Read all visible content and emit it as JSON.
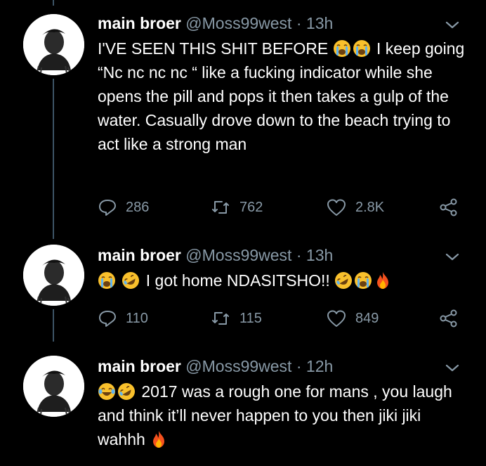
{
  "tweets": [
    {
      "name": "main broer",
      "handle": "@Moss99west",
      "separator": "·",
      "time": "13h",
      "lines": [
        [
          "emoji:sob",
          "emoji:sob"
        ],
        []
      ],
      "text_parts": {
        "a": "I'VE SEEN THIS SHIT BEFORE",
        "b": "I keep going “Nc nc nc nc “ like a fucking indicator while she opens the pill and pops it then takes a gulp of the water. Casually drove down to the beach trying to act like a strong man"
      },
      "emojis": [
        "crying-face-emoji",
        "crying-face-emoji"
      ],
      "replies": "286",
      "retweets": "762",
      "likes": "2.8K"
    },
    {
      "name": "main broer",
      "handle": "@Moss99west",
      "separator": "·",
      "time": "13h",
      "text_parts": {
        "a": "I got home NDASITSHO!!"
      },
      "emojis_before": [
        "crying-face-emoji",
        "rolling-laughing-emoji"
      ],
      "emojis_after": [
        "rolling-laughing-emoji",
        "crying-face-emoji",
        "fire-emoji"
      ],
      "replies": "110",
      "retweets": "115",
      "likes": "849"
    },
    {
      "name": "main broer",
      "handle": "@Moss99west",
      "separator": "·",
      "time": "12h",
      "text_parts": {
        "a": "2017 was a rough one for mans , you laugh and think it’ll never happen to you then jiki jiki wahhh"
      },
      "emojis_before": [
        "tears-of-joy-emoji",
        "rolling-laughing-emoji"
      ],
      "emojis_after": [
        "fire-emoji"
      ]
    }
  ],
  "colors": {
    "background": "#000000",
    "muted": "#8899a6",
    "thread": "#3d5466"
  }
}
